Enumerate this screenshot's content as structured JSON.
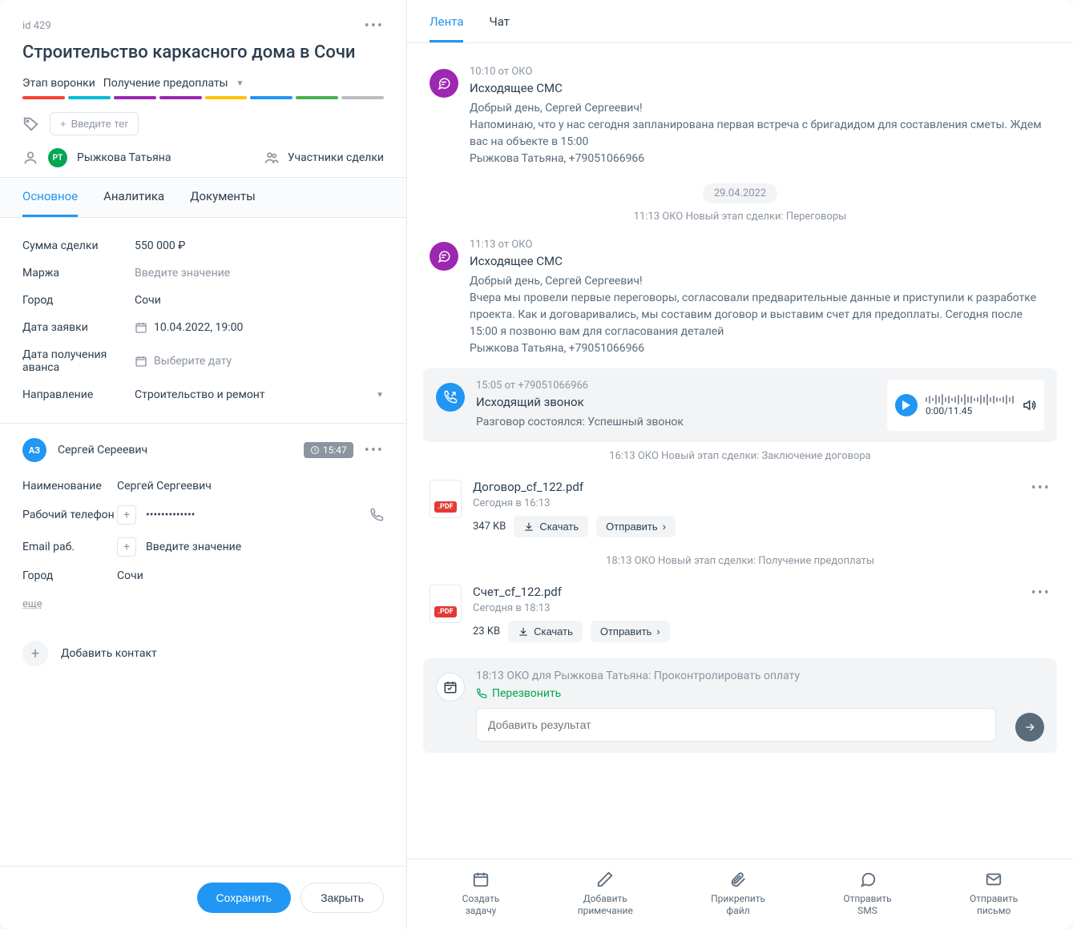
{
  "deal": {
    "id_label": "id 429",
    "title": "Строительство каркасного дома в Сочи",
    "stage_label": "Этап воронки",
    "stage_value": "Получение предоплаты",
    "stage_colors": [
      "#f44336",
      "#00bcd4",
      "#9c27b0",
      "#9c27b0",
      "#ffc107",
      "#2196f3",
      "#4caf50",
      "#bdbdbd"
    ],
    "tag_placeholder": "Введите тег",
    "owner_avatar": "РТ",
    "owner_name": "Рыжкова Татьяна",
    "participants_label": "Участники сделки"
  },
  "left_tabs": [
    "Основное",
    "Аналитика",
    "Документы"
  ],
  "fields": {
    "sum_label": "Сумма сделки",
    "sum_value": "550 000 ₽",
    "margin_label": "Маржа",
    "margin_placeholder": "Введите значение",
    "city_label": "Город",
    "city_value": "Сочи",
    "reqdate_label": "Дата заявки",
    "reqdate_value": "10.04.2022, 19:00",
    "advdate_label": "Дата получения аванса",
    "advdate_placeholder": "Выберите дату",
    "direction_label": "Направление",
    "direction_value": "Строительство и ремонт"
  },
  "contact": {
    "avatar": "АЗ",
    "name": "Сергей Сереевич",
    "time_badge": "15:47",
    "title_label": "Наименование",
    "title_value": "Сергей Сергеевич",
    "phone_label": "Рабочий телефон",
    "phone_value": "•••••••••••••",
    "email_label": "Email раб.",
    "email_placeholder": "Введите значение",
    "city_label": "Город",
    "city_value": "Сочи",
    "more": "еще"
  },
  "add_contact": "Добавить контакт",
  "buttons": {
    "save": "Сохранить",
    "close": "Закрыть"
  },
  "right_tabs": [
    "Лента",
    "Чат"
  ],
  "feed": {
    "msg1": {
      "time": "10:10 от ОКО",
      "title": "Исходящее СМС",
      "l1": "Добрый день, Сергей Сергеевич!",
      "l2": "Напоминаю, что у нас  сегодня запланирована первая встреча с бригадидом для составления сметы. Ждем вас  на объекте в 15:00",
      "l3": "Рыжкова Татьяна, +79051066966"
    },
    "date1": "29.04.2022",
    "stage1": "11:13 ОКО Новый этап сделки: Переговоры",
    "msg2": {
      "time": "11:13 от ОКО",
      "title": "Исходящее СМС",
      "l1": "Добрый день, Сергей Сергеевич!",
      "l2": "Вчера мы провели первые переговоры, согласовали предварительные данные и приступили к разработке проекта. Как и договаривались, мы составим договор и выставим счет для предоплаты. Сегодня после 15:00 я позвоню вам для согласования деталей",
      "l3": "Рыжкова Татьяна, +79051066966"
    },
    "call": {
      "time": "15:05 от +79051066966",
      "title": "Исходящий звонок",
      "status": "Разговор состоялся: Успешный звонок",
      "duration": "0:00/11.45"
    },
    "stage2": "16:13 ОКО Новый этап сделки: Заключение договора",
    "file1": {
      "name": "Договор_cf_122.pdf",
      "meta": "Сегодня в 16:13",
      "size": "347 KB",
      "download": "Скачать",
      "send": "Отправить"
    },
    "stage3": "18:13 ОКО Новый этап сделки: Получение предоплаты",
    "file2": {
      "name": "Счет_cf_122.pdf",
      "meta": "Сегодня в 18:13",
      "size": "23 KB",
      "download": "Скачать",
      "send": "Отправить"
    },
    "task": {
      "title": "18:13 ОКО для Рыжкова Татьяна: Проконтролировать оплату",
      "callback": "Перезвонить",
      "placeholder": "Добавить результат"
    }
  },
  "actions": {
    "task": "Создать\nзадачу",
    "note": "Добавить\nпримечание",
    "attach": "Прикрепить\nфайл",
    "sms": "Отправить\nSMS",
    "mail": "Отправить\nписьмо"
  },
  "pdf_badge": ".PDF"
}
